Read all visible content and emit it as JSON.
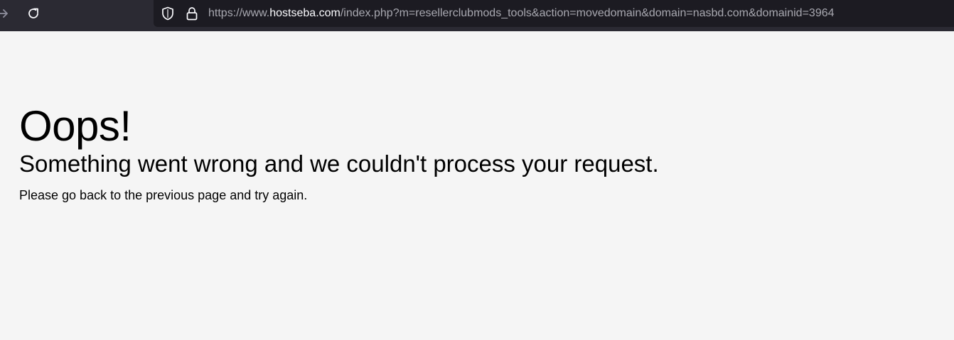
{
  "browser": {
    "url_prefix": "https://www.",
    "url_domain": "hostseba.com",
    "url_path": "/index.php?m=resellerclubmods_tools&action=movedomain&domain=nasbd.com&domainid=3964",
    "icons": {
      "forward": "arrow-right-icon",
      "reload": "reload-icon",
      "tracking_protection": "shield-icon",
      "security": "lock-icon"
    }
  },
  "page": {
    "heading": "Oops!",
    "subheading": "Something went wrong and we couldn't process your request.",
    "message": "Please go back to the previous page and try again."
  }
}
